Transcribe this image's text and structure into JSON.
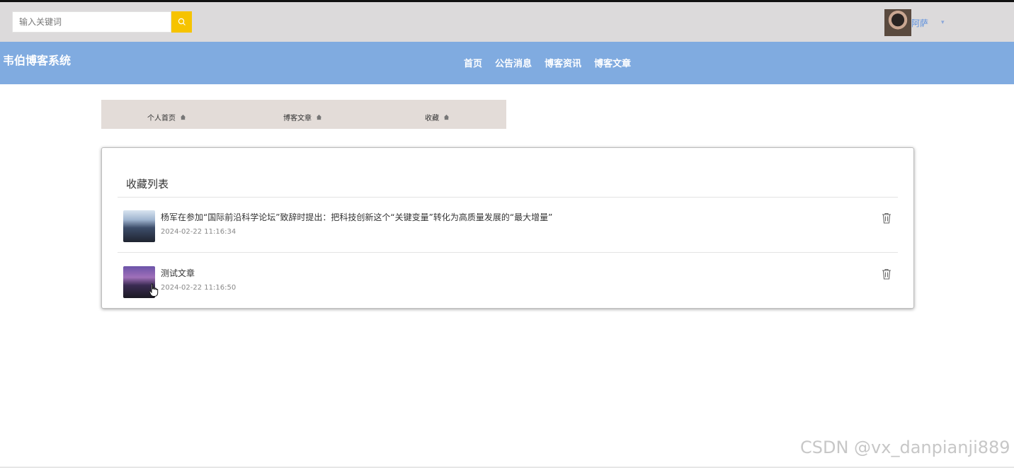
{
  "header": {
    "search_placeholder": "输入关键词",
    "user_name": "阿萨",
    "caret": "▾"
  },
  "navbar": {
    "brand": "韦伯博客系统",
    "links": [
      "首页",
      "公告消息",
      "博客资讯",
      "博客文章"
    ]
  },
  "subnav": {
    "items": [
      "个人首页",
      "博客文章",
      "收藏"
    ]
  },
  "favorites": {
    "title": "收藏列表",
    "items": [
      {
        "title": "杨军在参加“国际前沿科学论坛”致辞时提出：把科技创新这个“关键变量”转化为高质量发展的“最大增量”",
        "time": "2024-02-22 11:16:34"
      },
      {
        "title": "测试文章",
        "time": "2024-02-22 11:16:50"
      }
    ]
  },
  "watermark": "CSDN @vx_danpianji889",
  "colors": {
    "topbar": "#dcdadb",
    "navbar": "#80abe0",
    "search_button": "#f6c300",
    "subnav": "#e3dcd8"
  }
}
